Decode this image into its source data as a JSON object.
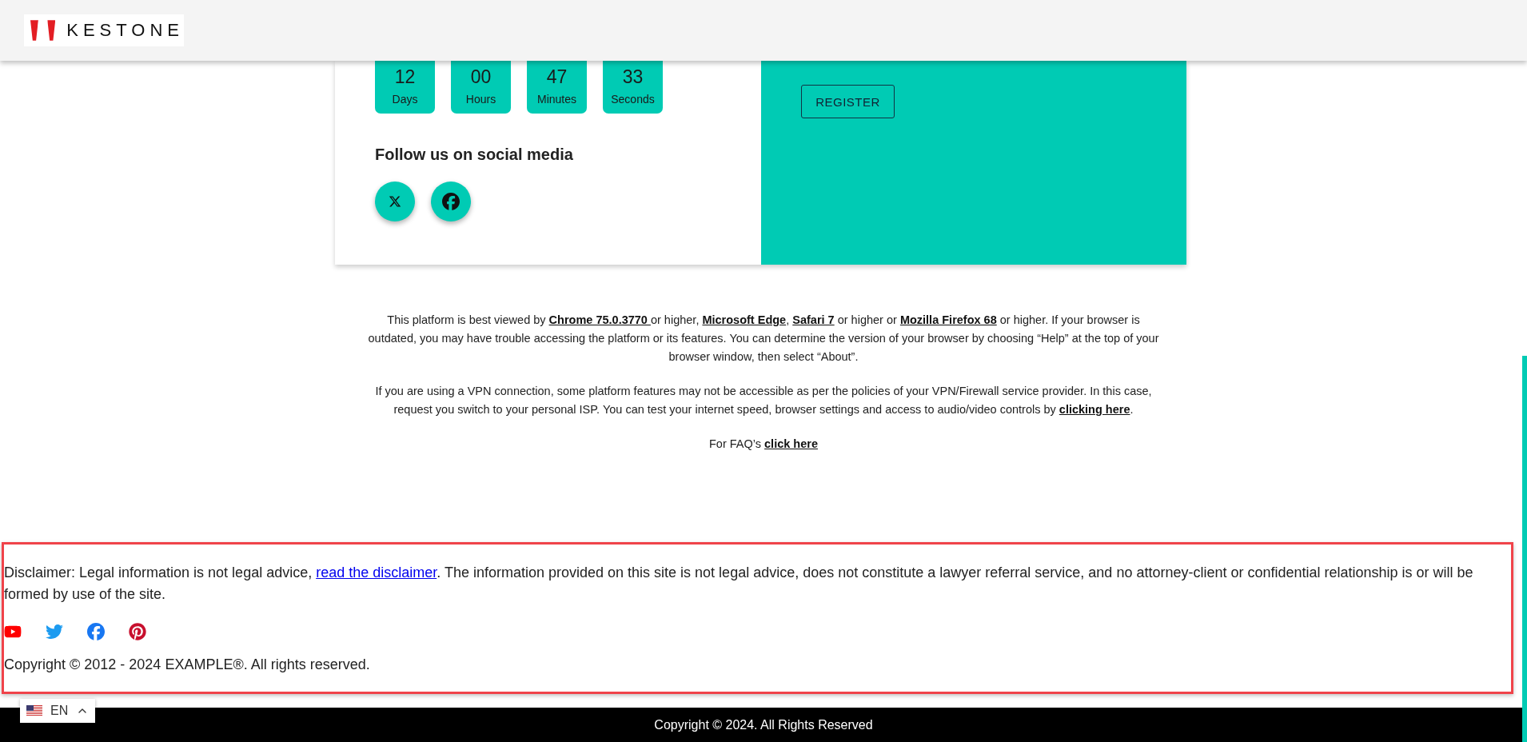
{
  "header": {
    "logo_text": "KESTONE"
  },
  "countdown": [
    {
      "value": "12",
      "unit": "Days"
    },
    {
      "value": "00",
      "unit": "Hours"
    },
    {
      "value": "47",
      "unit": "Minutes"
    },
    {
      "value": "33",
      "unit": "Seconds"
    }
  ],
  "social": {
    "heading": "Follow us on social media",
    "buttons": [
      {
        "kind": "x"
      },
      {
        "kind": "facebook"
      }
    ]
  },
  "register_button": "REGISTER",
  "info_paragraphs": [
    [
      {
        "kind": "text",
        "text": "This platform is best viewed by "
      },
      {
        "kind": "link",
        "text": "Chrome 75.0.3770 "
      },
      {
        "kind": "text",
        "text": "or higher, "
      },
      {
        "kind": "link",
        "text": "Microsoft Edge"
      },
      {
        "kind": "text",
        "text": ", "
      },
      {
        "kind": "link",
        "text": "Safari 7"
      },
      {
        "kind": "text",
        "text": " or higher or "
      },
      {
        "kind": "link",
        "text": "Mozilla Firefox 68"
      },
      {
        "kind": "text",
        "text": " or higher. If your browser is outdated, you may have trouble accessing the platform or its features. You can determine the version of your browser by choosing “Help” at the top of your browser window, then select “About”."
      }
    ],
    [
      {
        "kind": "text",
        "text": "If you are using a VPN connection, some platform features may not be accessible as per the policies of your VPN/Firewall service provider. In this case, request you switch to your personal ISP. You can test your internet speed, browser settings and access to audio/video controls by "
      },
      {
        "kind": "link",
        "text": "clicking here"
      },
      {
        "kind": "text",
        "text": "."
      }
    ],
    [
      {
        "kind": "text",
        "text": "For FAQ’s "
      },
      {
        "kind": "link",
        "text": "click here"
      }
    ]
  ],
  "disclaimer": [
    {
      "kind": "text",
      "text": "Disclaimer: Legal information is not legal advice, "
    },
    {
      "kind": "link",
      "text": "read the disclaimer"
    },
    {
      "kind": "text",
      "text": ". The information provided on this site is not legal advice, does not constitute a lawyer referral service, and no attorney-client or confidential relationship is or will be formed by use of the site."
    }
  ],
  "footer_social": [
    {
      "kind": "youtube"
    },
    {
      "kind": "twitter"
    },
    {
      "kind": "facebook"
    },
    {
      "kind": "pinterest"
    }
  ],
  "site_copyright": "Copyright © 2012 - 2024 EXAMPLE®. All rights reserved.",
  "language": {
    "code": "EN"
  },
  "footer_bar": "Copyright © 2024. All Rights Reserved"
}
